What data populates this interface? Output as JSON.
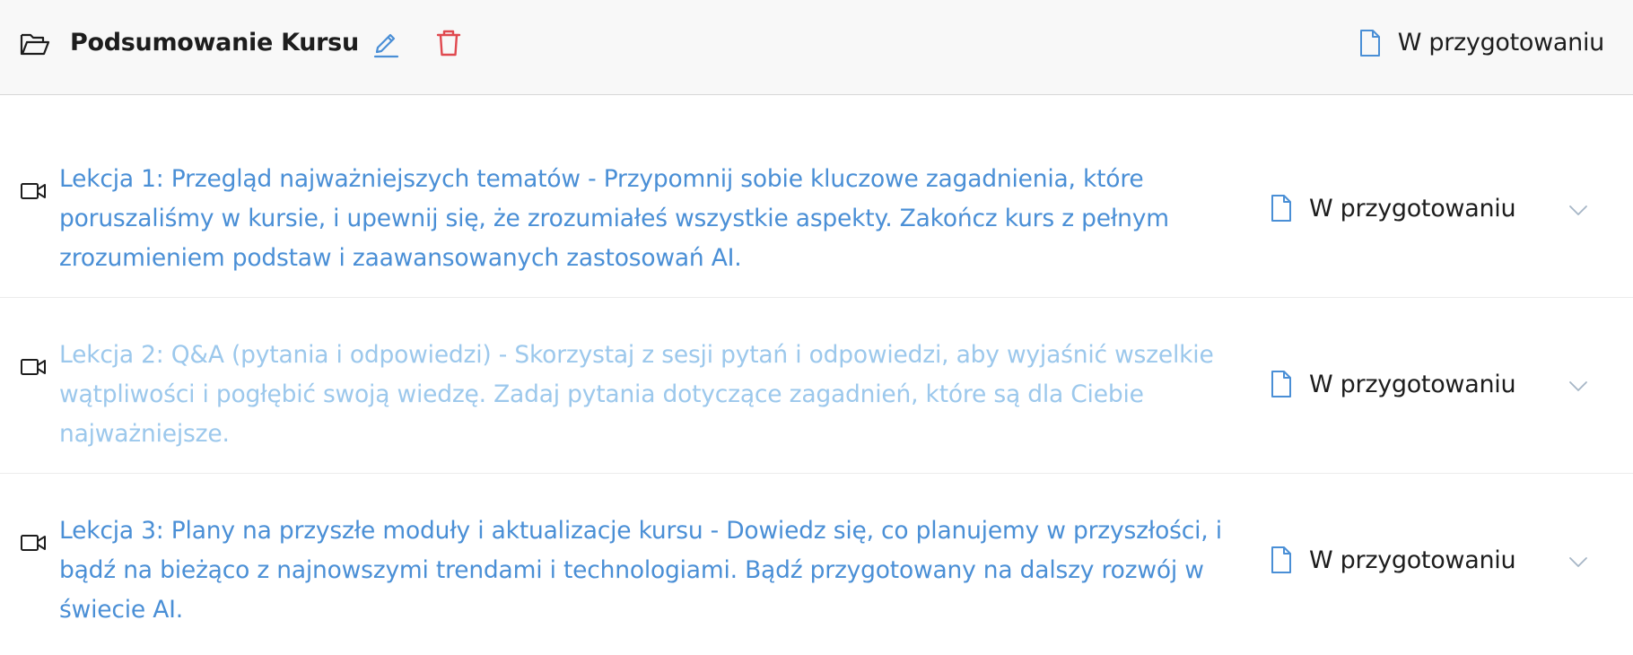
{
  "header": {
    "title": "Podsumowanie Kursu",
    "status": "W przygotowaniu",
    "icons": [
      "folder-open-icon",
      "pencil-icon",
      "trash-icon",
      "document-icon"
    ]
  },
  "lessons": [
    {
      "text": "Lekcja 1: Przegląd najważniejszych tematów - Przypomnij sobie kluczowe zagadnienia, które poruszaliśmy w kursie, i upewnij się, że zrozumiałeś wszystkie aspekty. Zakończ kurs z pełnym zrozumieniem podstaw i zaawansowanych zastosowań AI.",
      "status": "W przygotowaniu",
      "text_color": "#4a8fd6"
    },
    {
      "text": "Lekcja 2: Q&A (pytania i odpowiedzi) - Skorzystaj z sesji pytań i odpowiedzi, aby wyjaśnić wszelkie wątpliwości i pogłębić swoją wiedzę. Zadaj pytania dotyczące zagadnień, które są dla Ciebie najważniejsze.",
      "status": "W przygotowaniu",
      "text_color": "#9cc8ec"
    },
    {
      "text": "Lekcja 3: Plany na przyszłe moduły i aktualizacje kursu - Dowiedz się, co planujemy w przyszłości, i bądź na bieżąco z najnowszymi trendami i technologiami. Bądź przygotowany na dalszy rozwój w świecie AI.",
      "status": "W przygotowaniu",
      "text_color": "#4a8fd6"
    }
  ],
  "colors": {
    "accent": "#4a8fd6",
    "muted_accent": "#9cc8ec",
    "delete": "#e0494f",
    "header_bg": "#f8f8f8",
    "divider": "#ececec"
  }
}
